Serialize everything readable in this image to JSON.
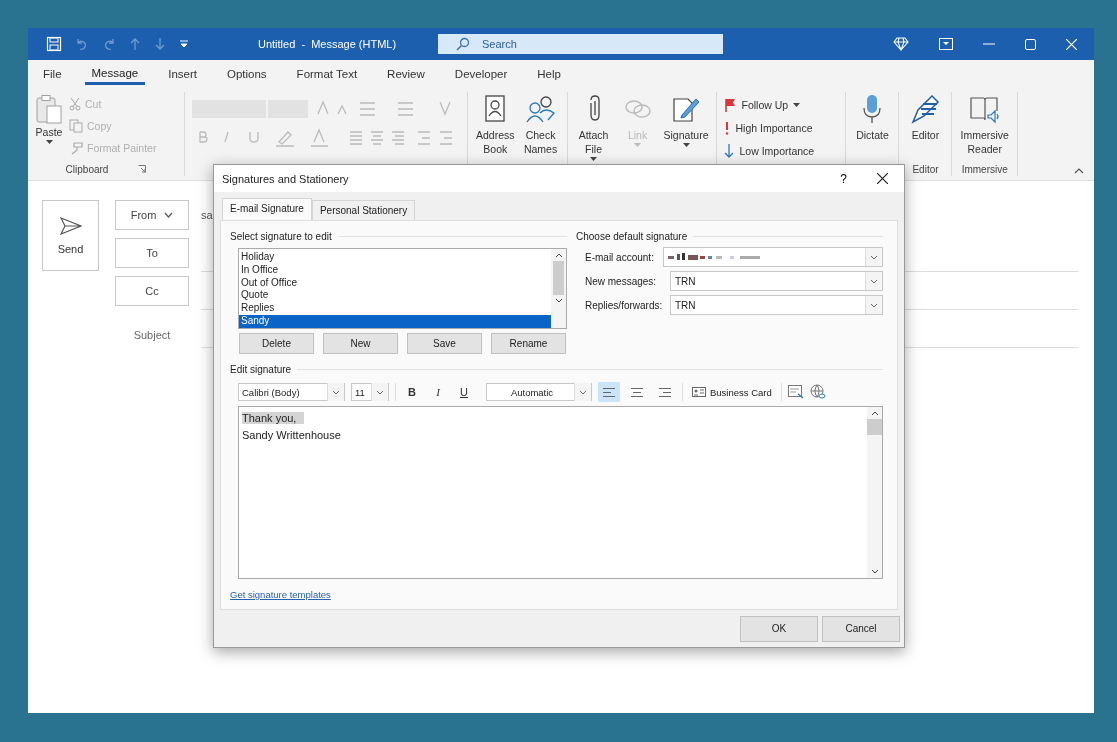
{
  "window": {
    "title": "Untitled  -  Message (HTML)",
    "search": {
      "placeholder": "Search"
    }
  },
  "menu_tabs": [
    {
      "label": "File",
      "selected": false
    },
    {
      "label": "Message",
      "selected": true
    },
    {
      "label": "Insert",
      "selected": false
    },
    {
      "label": "Options",
      "selected": false
    },
    {
      "label": "Format Text",
      "selected": false
    },
    {
      "label": "Review",
      "selected": false
    },
    {
      "label": "Developer",
      "selected": false
    },
    {
      "label": "Help",
      "selected": false
    }
  ],
  "ribbon": {
    "clipboard": {
      "label": "Clipboard",
      "paste": "Paste",
      "items": [
        {
          "kind": "cut",
          "label": "Cut",
          "disabled": true
        },
        {
          "kind": "copy",
          "label": "Copy",
          "disabled": true
        },
        {
          "kind": "painter",
          "label": "Format Painter",
          "disabled": true
        }
      ]
    },
    "groups": [
      {
        "kind": "buttons",
        "buttons": [
          {
            "kind": "address-book",
            "lines": [
              "Address",
              "Book"
            ],
            "dropdown": false,
            "disabled": false
          },
          {
            "kind": "check-names",
            "lines": [
              "Check",
              "Names"
            ],
            "dropdown": false,
            "disabled": false
          }
        ]
      },
      {
        "kind": "buttons",
        "buttons": [
          {
            "kind": "attach",
            "lines": [
              "Attach",
              "File"
            ],
            "dropdown": true,
            "disabled": false
          },
          {
            "kind": "link",
            "lines": [
              "Link"
            ],
            "dropdown": true,
            "disabled": true
          },
          {
            "kind": "signature",
            "lines": [
              "Signature"
            ],
            "dropdown": true,
            "disabled": false
          }
        ]
      },
      {
        "kind": "stack",
        "items": [
          {
            "kind": "flag",
            "label": "Follow Up",
            "dropdown": true
          },
          {
            "kind": "high",
            "label": "High Importance",
            "dropdown": false
          },
          {
            "kind": "low",
            "label": "Low Importance",
            "dropdown": false
          }
        ]
      },
      {
        "kind": "buttons",
        "buttons": [
          {
            "kind": "mic",
            "lines": [
              "Dictate"
            ],
            "dropdown": false,
            "disabled": false
          }
        ]
      },
      {
        "kind": "buttons",
        "label": "Editor",
        "buttons": [
          {
            "kind": "editor",
            "lines": [
              "Editor"
            ],
            "dropdown": false,
            "disabled": false
          }
        ]
      },
      {
        "kind": "buttons",
        "label": "Immersive",
        "buttons": [
          {
            "kind": "reader",
            "lines": [
              "Immersive",
              "Reader"
            ],
            "dropdown": false,
            "disabled": false
          }
        ]
      }
    ]
  },
  "compose": {
    "send": "Send",
    "from": "From",
    "from_value": "sa",
    "to": "To",
    "cc": "Cc",
    "subject": "Subject"
  },
  "dialog": {
    "title": "Signatures and Stationery",
    "help": "?",
    "tabs": [
      {
        "label": "E-mail Signature",
        "selected": true
      },
      {
        "label": "Personal Stationery",
        "selected": false
      }
    ],
    "select_label": "Select signature to edit",
    "signatures": [
      {
        "label": "Holiday",
        "selected": false
      },
      {
        "label": "In Office",
        "selected": false
      },
      {
        "label": "Out of Office",
        "selected": false
      },
      {
        "label": "Quote",
        "selected": false
      },
      {
        "label": "Replies",
        "selected": false
      },
      {
        "label": "Sandy",
        "selected": true
      }
    ],
    "list_buttons": [
      "Delete",
      "New",
      "Save",
      "Rename"
    ],
    "default_label": "Choose default signature",
    "defaults": [
      {
        "label": "E-mail account:"
      },
      {
        "label": "New messages:",
        "value": "TRN"
      },
      {
        "label": "Replies/forwards:",
        "value": "TRN"
      }
    ],
    "edit_label": "Edit signature",
    "toolbar": {
      "font": "Calibri (Body)",
      "size": "11",
      "formats": [
        {
          "kind": "bold",
          "label": "B"
        },
        {
          "kind": "italic",
          "label": "I"
        },
        {
          "kind": "underline",
          "label": "U"
        }
      ],
      "color_field": "Automatic",
      "align": [
        {
          "kind": "left",
          "selected": true
        },
        {
          "kind": "center",
          "selected": false
        },
        {
          "kind": "right",
          "selected": false
        }
      ],
      "business_card": "Business Card"
    },
    "lines": [
      {
        "text": "Thank you,",
        "highlighted": true
      },
      {
        "text": "Sandy Writtenhouse",
        "highlighted": false
      }
    ],
    "templates_link": "Get signature templates",
    "buttons": [
      "OK",
      "Cancel"
    ]
  }
}
